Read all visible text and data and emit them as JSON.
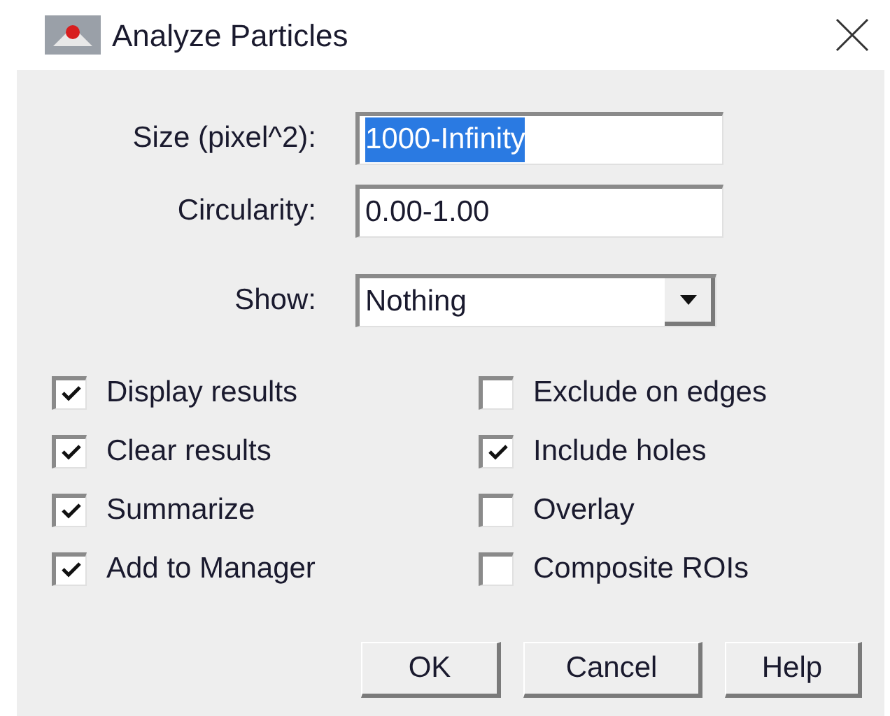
{
  "window": {
    "title": "Analyze Particles"
  },
  "fields": [
    {
      "label": "Size (pixel^2):",
      "value": "1000-Infinity",
      "selected": true
    },
    {
      "label": "Circularity:",
      "value": "0.00-1.00",
      "selected": false
    }
  ],
  "show": {
    "label": "Show:",
    "value": "Nothing"
  },
  "checkboxes": [
    {
      "label": "Display results",
      "checked": true
    },
    {
      "label": "Exclude on edges",
      "checked": false
    },
    {
      "label": "Clear results",
      "checked": true
    },
    {
      "label": "Include holes",
      "checked": true
    },
    {
      "label": "Summarize",
      "checked": true
    },
    {
      "label": "Overlay",
      "checked": false
    },
    {
      "label": "Add to Manager",
      "checked": true
    },
    {
      "label": "Composite ROIs",
      "checked": false
    }
  ],
  "buttons": [
    "OK",
    "Cancel",
    "Help"
  ]
}
